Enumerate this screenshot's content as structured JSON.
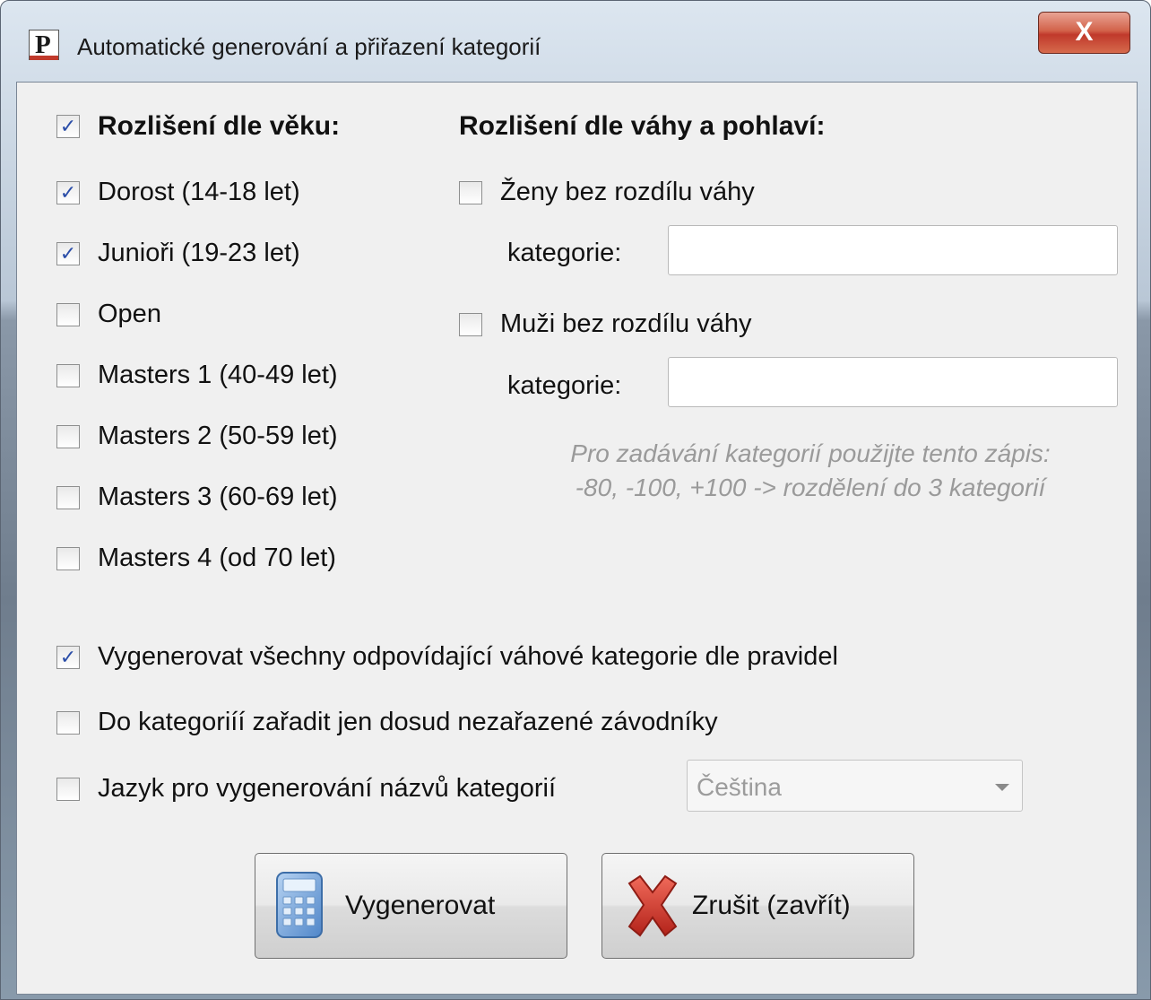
{
  "window": {
    "title": "Automatické generování a přiřazení kategorií",
    "close_glyph": "X",
    "app_icon_letter": "P"
  },
  "age": {
    "header": "Rozlišení dle věku:",
    "header_checked": true,
    "items": [
      {
        "label": "Dorost  (14-18 let)",
        "checked": true
      },
      {
        "label": "Junioři  (19-23 let)",
        "checked": true
      },
      {
        "label": "Open",
        "checked": false
      },
      {
        "label": "Masters 1 (40-49 let)",
        "checked": false
      },
      {
        "label": "Masters 2 (50-59 let)",
        "checked": false
      },
      {
        "label": "Masters 3 (60-69 let)",
        "checked": false
      },
      {
        "label": "Masters 4 (od 70 let)",
        "checked": false
      }
    ]
  },
  "weight": {
    "header": "Rozlišení dle váhy a pohlaví:",
    "women_label": "Ženy bez rozdílu váhy",
    "women_checked": false,
    "women_category_label": "kategorie:",
    "women_category_value": "",
    "men_label": "Muži bez rozdílu váhy",
    "men_checked": false,
    "men_category_label": "kategorie:",
    "men_category_value": "",
    "hint_line1": "Pro zadávání kategorií použijte tento zápis:",
    "hint_line2": "-80, -100, +100 -> rozdělení do 3 kategorií"
  },
  "options": {
    "generate_all_label": "Vygenerovat všechny odpovídající váhové kategorie dle pravidel",
    "generate_all_checked": true,
    "unassigned_only_label": "Do kategoriíí zařadit jen dosud nezařazené závodníky",
    "unassigned_only_checked": false,
    "language_label": "Jazyk pro vygenerování názvů kategorií",
    "language_checked": false,
    "language_value": "Čeština"
  },
  "buttons": {
    "generate_label": "Vygenerovat",
    "generate_icon": "calculator-icon",
    "cancel_label": "Zrušit (zavřít)",
    "cancel_icon": "red-x-icon"
  },
  "check_glyph": "✓",
  "colors": {
    "check": "#2a4da8",
    "close_button": "#c0392b",
    "hint_text": "#9a9a9a",
    "cancel_x": "#d32f2f"
  }
}
